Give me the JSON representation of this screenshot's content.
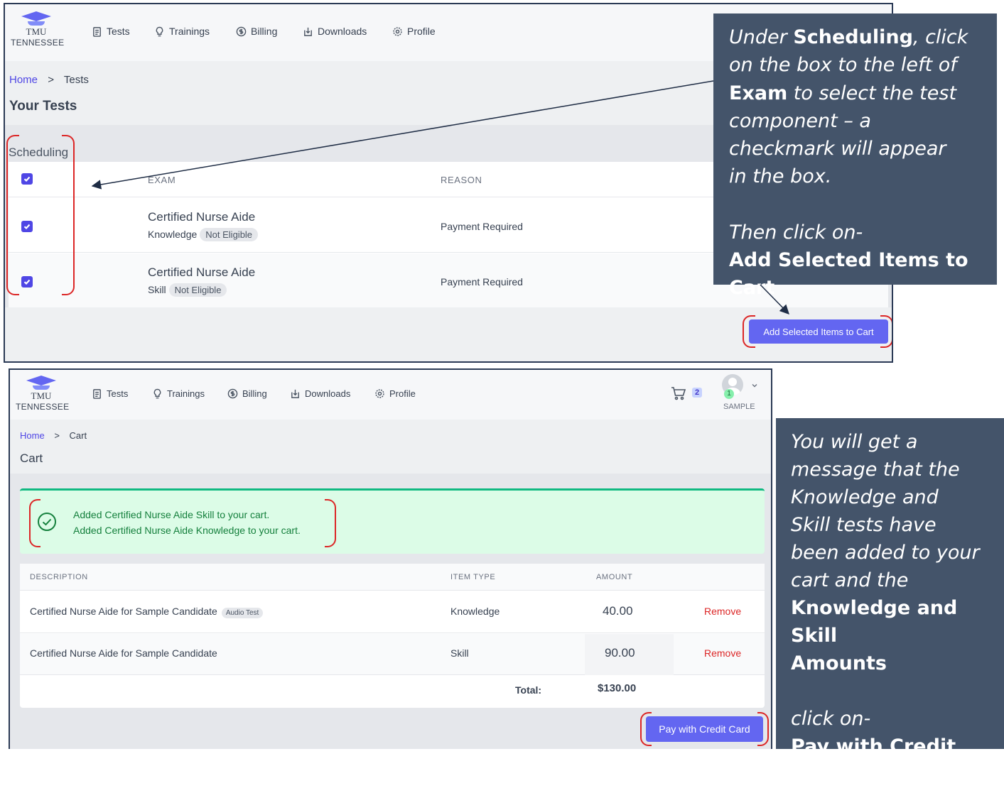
{
  "top": {
    "logo": {
      "name": "TMU",
      "state": "TENNESSEE"
    },
    "nav": {
      "tests": "Tests",
      "trainings": "Trainings",
      "billing": "Billing",
      "downloads": "Downloads",
      "profile": "Profile"
    },
    "breadcrumb": {
      "home": "Home",
      "sep": ">",
      "current": "Tests"
    },
    "page_title": "Your Tests",
    "section_title": "Scheduling",
    "table": {
      "headers": {
        "exam": "EXAM",
        "reason": "REASON"
      },
      "rows": [
        {
          "title": "Certified Nurse Aide",
          "type": "Knowledge",
          "badge": "Not Eligible",
          "reason": "Payment Required"
        },
        {
          "title": "Certified Nurse Aide",
          "type": "Skill",
          "badge": "Not Eligible",
          "reason": "Payment Required"
        }
      ]
    },
    "add_button": "Add Selected Items to Cart",
    "callout": {
      "l1a": "Under ",
      "l1b": "Scheduling",
      "l1c": ", click",
      "l2": "on the box to the left of",
      "l3a": "Exam",
      "l3b": " to select the test",
      "l4": "component – a",
      "l5": "checkmark will appear",
      "l6": "in the box.",
      "l7": "Then click on-",
      "l8": "Add Selected Items to Cart"
    }
  },
  "bottom": {
    "logo": {
      "name": "TMU",
      "state": "TENNESSEE"
    },
    "nav": {
      "tests": "Tests",
      "trainings": "Trainings",
      "billing": "Billing",
      "downloads": "Downloads",
      "profile": "Profile"
    },
    "cart_count": "2",
    "user": {
      "badge": "1",
      "name": "SAMPLE"
    },
    "breadcrumb": {
      "home": "Home",
      "sep": ">",
      "current": "Cart"
    },
    "page_title": "Cart",
    "alert": {
      "line1": "Added Certified Nurse Aide Skill to your cart.",
      "line2": "Added Certified Nurse Aide Knowledge to your cart."
    },
    "table": {
      "headers": {
        "description": "DESCRIPTION",
        "item_type": "ITEM TYPE",
        "amount": "AMOUNT"
      },
      "rows": [
        {
          "description": "Certified Nurse Aide for Sample Candidate",
          "tag": "Audio Test",
          "item_type": "Knowledge",
          "amount": "40.00",
          "action": "Remove"
        },
        {
          "description": "Certified Nurse Aide for Sample Candidate",
          "item_type": "Skill",
          "amount": "90.00",
          "action": "Remove"
        }
      ],
      "total_label": "Total:",
      "total_value": "$130.00"
    },
    "pay_button": "Pay with Credit Card",
    "callout": {
      "l1": "You will get a",
      "l2": "message that the",
      "l3": "Knowledge and",
      "l4": "Skill tests have",
      "l5": "been added to your",
      "l6": "cart and the",
      "l7": "Knowledge and Skill",
      "l8": "Amounts",
      "l9": "click on-",
      "l10": "Pay with Credit Card"
    }
  },
  "colors": {
    "accent": "#6366f1",
    "callout_bg": "#44546a",
    "highlight": "#dc2626",
    "success_bg": "#dcfce7",
    "success_text": "#15803d"
  }
}
